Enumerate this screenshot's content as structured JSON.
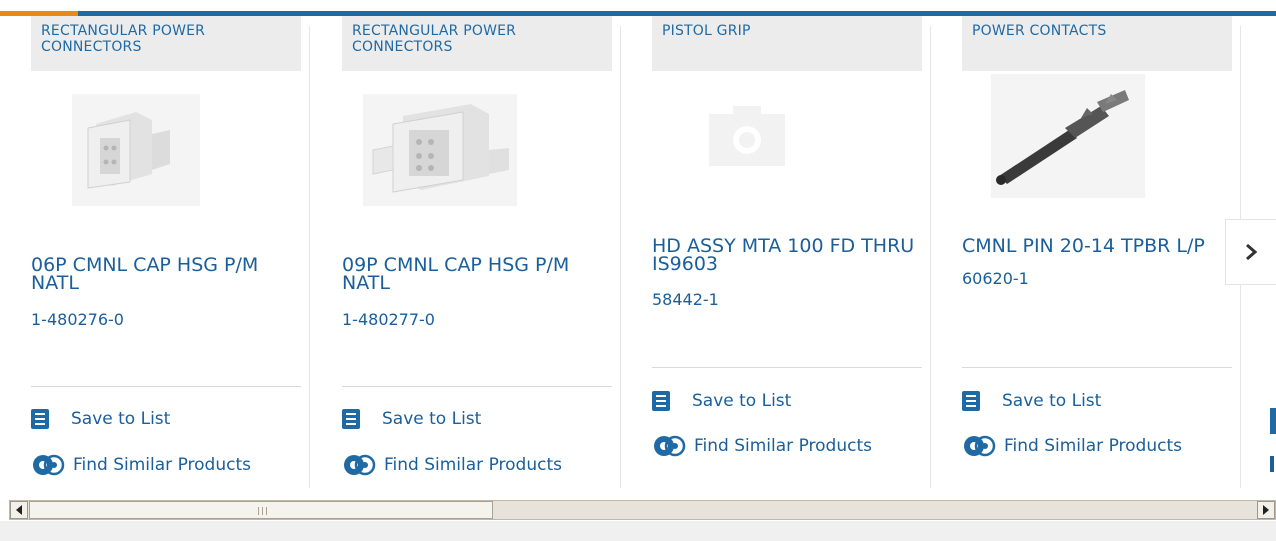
{
  "colors": {
    "brand_blue": "#1f6aa5",
    "accent_orange": "#e88a1a",
    "link_blue": "#1a5f9b"
  },
  "cards": [
    {
      "category": "RECTANGULAR POWER CONNECTORS",
      "title": "06P CMNL CAP HSG P/M NATL",
      "part_number": "1-480276-0",
      "save_label": "Save to List",
      "similar_label": "Find Similar Products",
      "image": "white-6-position-cap-housing"
    },
    {
      "category": "RECTANGULAR POWER CONNECTORS",
      "title": "09P CMNL CAP HSG P/M NATL",
      "part_number": "1-480277-0",
      "save_label": "Save to List",
      "similar_label": "Find Similar Products",
      "image": "white-9-position-cap-housing"
    },
    {
      "category": "PISTOL GRIP",
      "title": "HD ASSY MTA 100 FD THRU IS9603",
      "part_number": "58442-1",
      "save_label": "Save to List",
      "similar_label": "Find Similar Products",
      "image": "camera-placeholder-icon"
    },
    {
      "category": "POWER CONTACTS",
      "title": "CMNL PIN 20-14 TPBR L/P",
      "part_number": "60620-1",
      "save_label": "Save to List",
      "similar_label": "Find Similar Products",
      "image": "black-crimp-pin-contact"
    }
  ],
  "carousel": {
    "next_icon": "chevron-right-icon"
  },
  "scrollbar": {
    "left_icon": "arrow-left-icon",
    "right_icon": "arrow-right-icon"
  }
}
